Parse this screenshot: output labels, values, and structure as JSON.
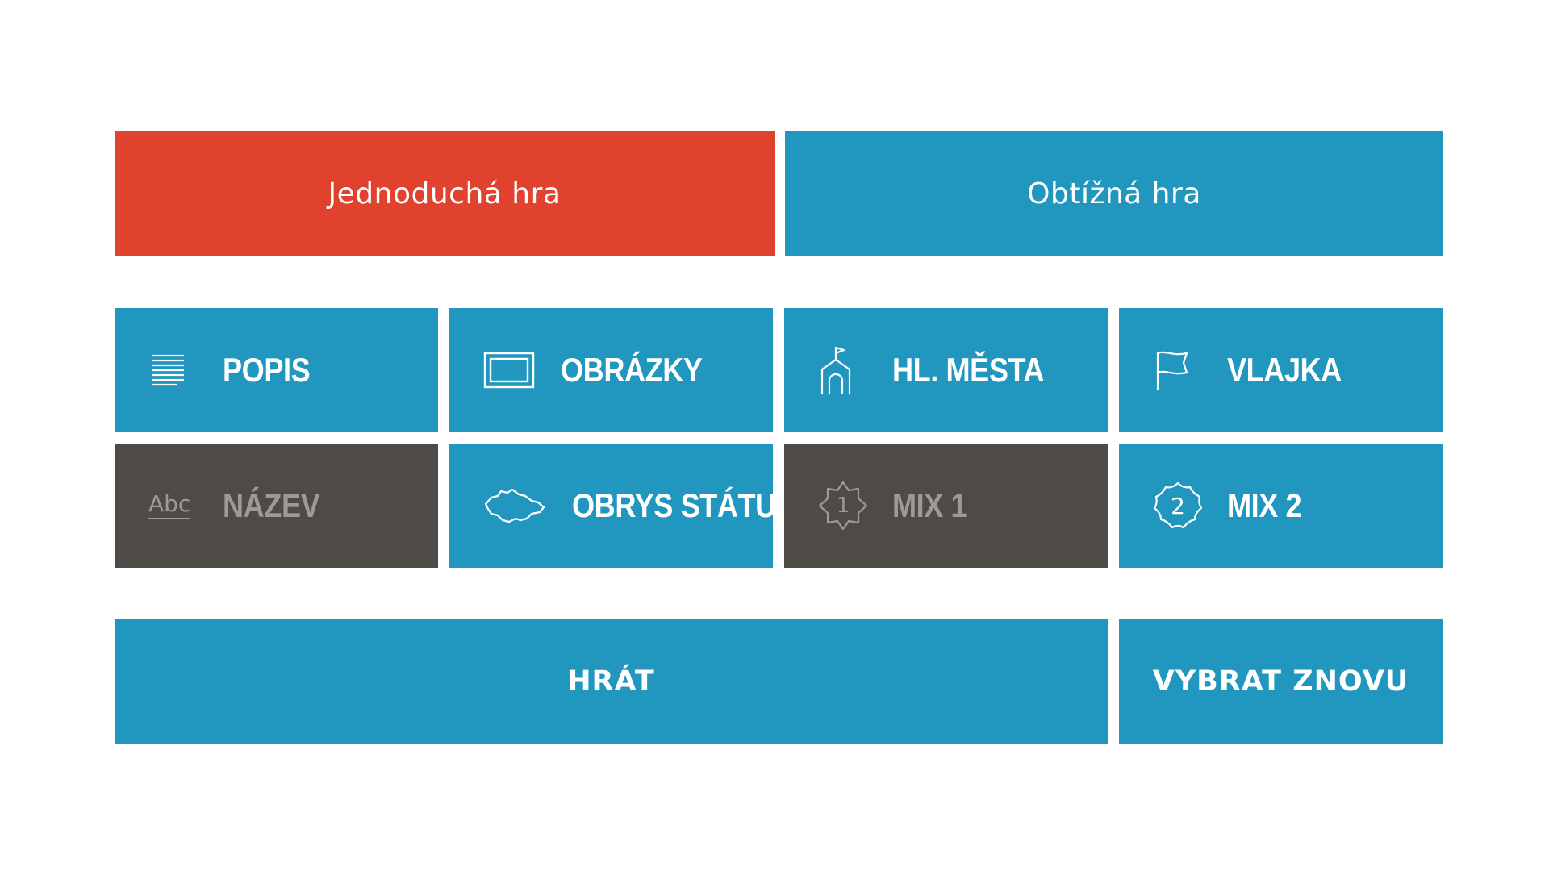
{
  "mode": {
    "easy_label": "Jednoduchá hra",
    "hard_label": "Obtížná hra",
    "selected": "easy"
  },
  "categories": [
    {
      "id": "popis",
      "label": "POPIS",
      "icon": "text-lines-icon",
      "enabled": true
    },
    {
      "id": "obrazky",
      "label": "OBRÁZKY",
      "icon": "picture-frame-icon",
      "enabled": true
    },
    {
      "id": "mesta",
      "label": "HL. MĚSTA",
      "icon": "capital-city-icon",
      "enabled": true
    },
    {
      "id": "vlajka",
      "label": "VLAJKA",
      "icon": "flag-icon",
      "enabled": true
    },
    {
      "id": "nazev",
      "label": "NÁZEV",
      "icon": "abc-text-icon",
      "enabled": false
    },
    {
      "id": "obrys",
      "label": "OBRYS STÁTU",
      "icon": "country-outline-icon",
      "enabled": true
    },
    {
      "id": "mix1",
      "label": "MIX 1",
      "icon": "mix-1-badge-icon",
      "enabled": false
    },
    {
      "id": "mix2",
      "label": "MIX 2",
      "icon": "mix-2-badge-icon",
      "enabled": true
    }
  ],
  "icons": {
    "abc_text": "Abc",
    "mix1_digit": "1",
    "mix2_digit": "2"
  },
  "actions": {
    "play_label": "HRÁT",
    "reset_label": "VYBRAT ZNOVU"
  },
  "colors": {
    "accent_red": "#e0422d",
    "primary_blue": "#2196be",
    "disabled_gray": "#4e4b47",
    "disabled_text": "#9e9994"
  }
}
